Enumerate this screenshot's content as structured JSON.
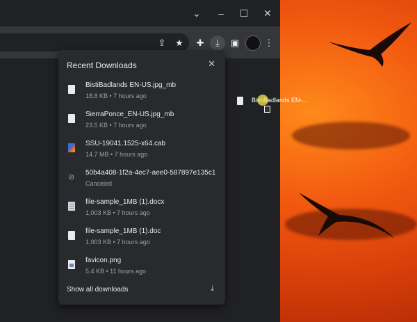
{
  "window": {
    "minimize_icon": "chevron-down",
    "min_glyph": "⌄",
    "restore_glyph": "–",
    "maximize_glyph": "☐",
    "close_glyph": "✕"
  },
  "toolbar": {
    "share_glyph": "⇪",
    "star_glyph": "★",
    "ext_glyph": "✚",
    "download_glyph": "⤓",
    "sidebar_glyph": "▣",
    "menu_glyph": "⋮"
  },
  "downloads": {
    "title": "Recent Downloads",
    "close_glyph": "✕",
    "items": [
      {
        "name": "BistiBadlands EN-US.jpg_mb",
        "status": "18.8 KB • 7 hours ago",
        "icon": "file"
      },
      {
        "name": "SierraPonce_EN-US.jpg_mb",
        "status": "23.5 KB • 7 hours ago",
        "icon": "file"
      },
      {
        "name": "SSU-19041.1525-x64.cab",
        "status": "14.7 MB • 7 hours ago",
        "icon": "cab"
      },
      {
        "name": "50b4a408-1f2a-4ec7-aee0-587897e135c1",
        "status": "Canceled",
        "icon": "canceled"
      },
      {
        "name": "file-sample_1MB (1).docx",
        "status": "1,003 KB • 7 hours ago",
        "icon": "doc"
      },
      {
        "name": "file-sample_1MB (1).doc",
        "status": "1,003 KB • 7 hours ago",
        "icon": "doc"
      },
      {
        "name": "favicon.png",
        "status": "5.4 KB • 11 hours ago",
        "icon": "png"
      }
    ],
    "show_all_label": "Show all downloads",
    "open_folder_glyph": "⤓"
  },
  "desktop": {
    "dragged_file_label": "BistiBadlands EN-..."
  }
}
